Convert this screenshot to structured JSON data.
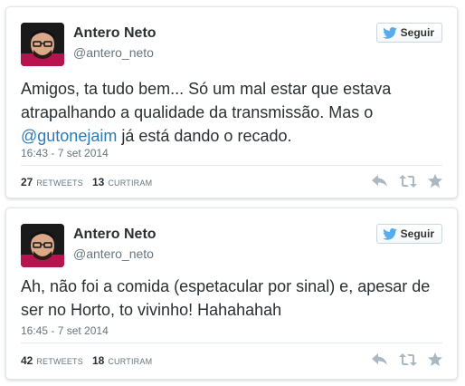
{
  "colors": {
    "twitter_blue": "#55acee",
    "mention": "#2b7bb9",
    "muted": "#66757f",
    "icon_gray": "#aab8c2"
  },
  "icons": {
    "follow": "twitter-bird-icon",
    "reply": "reply-icon",
    "retweet": "retweet-icon",
    "favorite": "star-icon"
  },
  "tweets": [
    {
      "author": {
        "name": "Antero Neto",
        "handle": "@antero_neto"
      },
      "follow_label": "Seguir",
      "text_before": "Amigos, ta tudo bem... Só um mal estar que estava atrapalhando a qualidade da transmissão. Mas o ",
      "mention": "@gutonejaim",
      "text_after": " já está dando o recado.",
      "date": "16:43 - 7 set 2014",
      "retweets": "27",
      "retweets_label": "Retweets",
      "likes": "13",
      "likes_label": "Curtiram"
    },
    {
      "author": {
        "name": "Antero Neto",
        "handle": "@antero_neto"
      },
      "follow_label": "Seguir",
      "text_before": "Ah, não foi a comida (espetacular por sinal) e, apesar de ser no Horto, to vivinho! Hahahahah",
      "mention": "",
      "text_after": "",
      "date": "16:45 - 7 set 2014",
      "retweets": "42",
      "retweets_label": "Retweets",
      "likes": "18",
      "likes_label": "Curtiram"
    }
  ]
}
